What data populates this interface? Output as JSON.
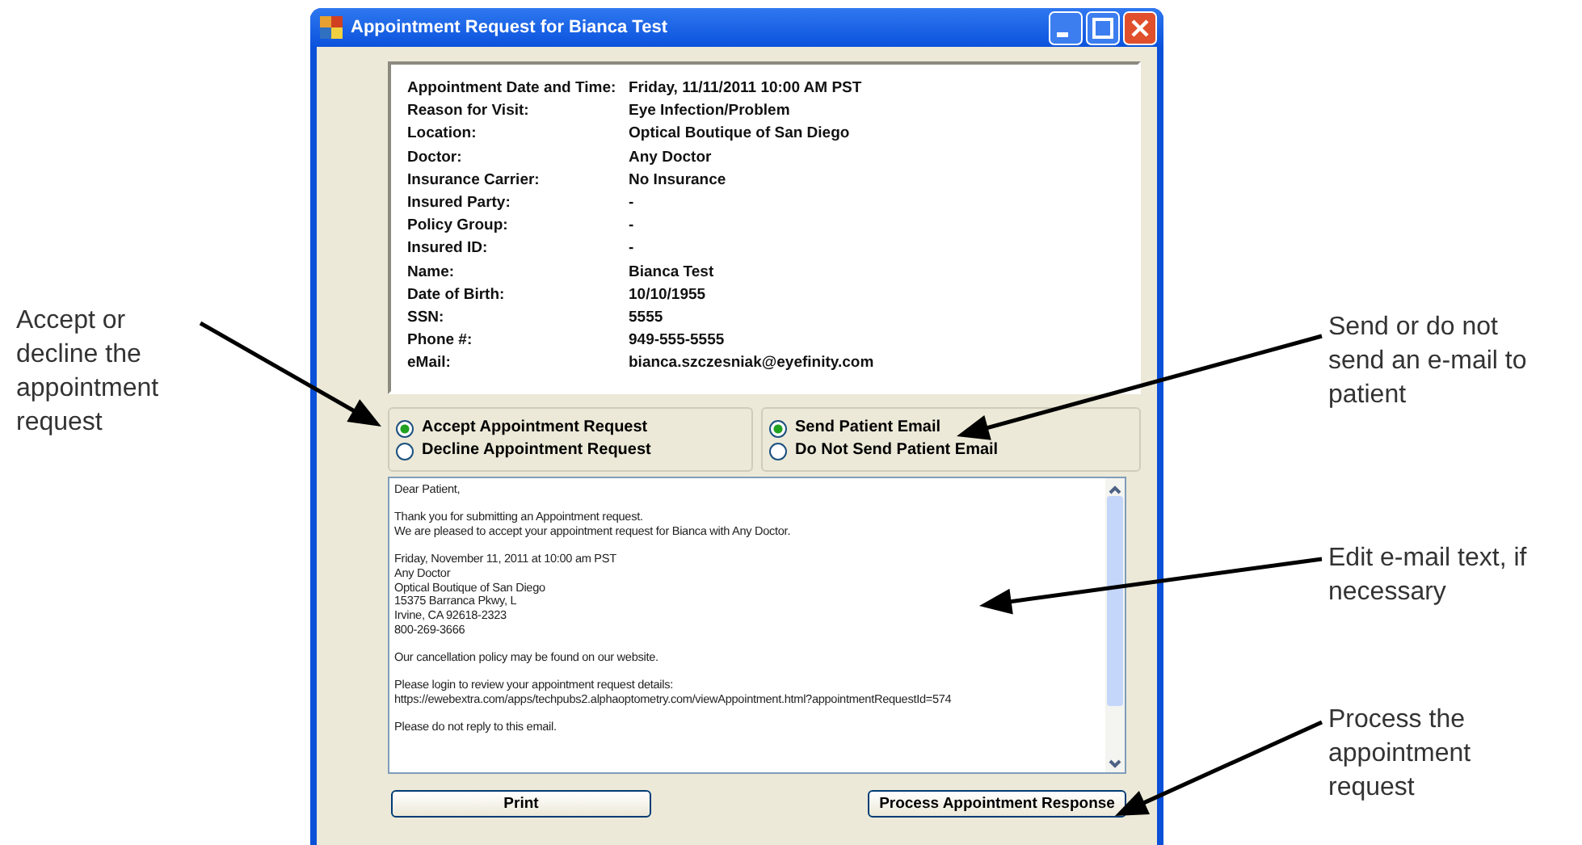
{
  "window": {
    "title": "Appointment Request for Bianca Test"
  },
  "details": [
    {
      "label": "Appointment Date and Time:",
      "value": "Friday, 11/11/2011 10:00 AM PST"
    },
    {
      "label": "Reason for Visit:",
      "value": "Eye Infection/Problem"
    },
    {
      "label": "Location:",
      "value": "Optical Boutique of San Diego"
    },
    {
      "label": "Doctor:",
      "value": "Any Doctor"
    },
    {
      "label": "Insurance Carrier:",
      "value": "No Insurance"
    },
    {
      "label": "Insured Party:",
      "value": "-"
    },
    {
      "label": "Policy Group:",
      "value": "-"
    },
    {
      "label": "Insured ID:",
      "value": "-"
    },
    {
      "label": "Name:",
      "value": "Bianca Test"
    },
    {
      "label": "Date of Birth:",
      "value": "10/10/1955"
    },
    {
      "label": "SSN:",
      "value": "5555"
    },
    {
      "label": "Phone #:",
      "value": "949-555-5555"
    },
    {
      "label": "eMail:",
      "value": "bianca.szczesniak@eyefinity.com"
    }
  ],
  "response_options": [
    {
      "label": "Accept Appointment Request",
      "selected": true
    },
    {
      "label": "Decline Appointment Request",
      "selected": false
    }
  ],
  "email_options": [
    {
      "label": "Send Patient Email",
      "selected": true
    },
    {
      "label": "Do Not Send Patient Email",
      "selected": false
    }
  ],
  "email_body": [
    [
      "Dear Patient,"
    ],
    [
      "Thank you for submitting an Appointment request.",
      "We are pleased to accept your appointment request for Bianca with Any Doctor."
    ],
    [
      "Friday, November 11, 2011 at 10:00 am PST",
      "Any Doctor",
      "Optical Boutique of San Diego",
      "15375 Barranca Pkwy, L",
      "Irvine, CA 92618-2323",
      "800-269-3666"
    ],
    [
      "Our cancellation policy may be found on our website."
    ],
    [
      "Please login to review your appointment request details:",
      "https://ewebextra.com/apps/techpubs2.alphaoptometry.com/viewAppointment.html?appointmentRequestId=574"
    ],
    [
      "Please do not reply to this email."
    ]
  ],
  "buttons": {
    "print": "Print",
    "process": "Process Appointment Response"
  },
  "callouts": [
    {
      "text": "Accept or decline the appointment request"
    },
    {
      "text": "Send or do not send an e-mail to patient"
    },
    {
      "text": "Edit e-mail text, if necessary"
    },
    {
      "text": "Process the appointment request"
    }
  ]
}
